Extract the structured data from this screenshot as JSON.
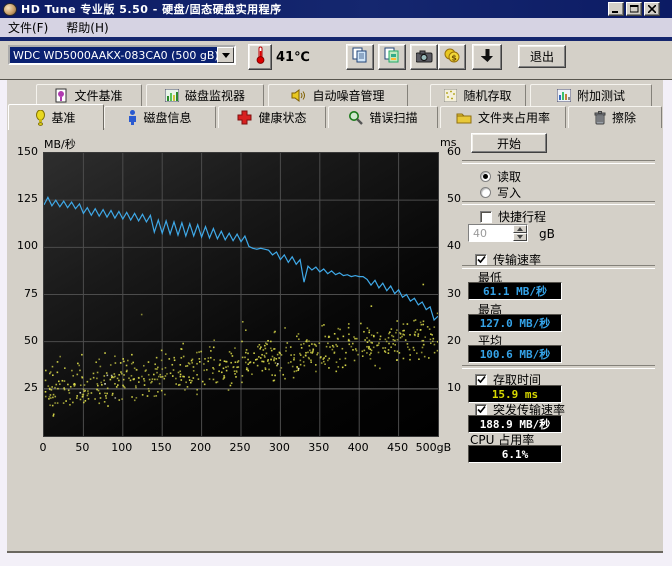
{
  "window": {
    "title": "HD Tune 专业版 5.50 - 硬盘/固态硬盘实用程序"
  },
  "menu": {
    "items": [
      "文件(F)",
      "帮助(H)"
    ]
  },
  "toolbar": {
    "drive_select": "WDC WD5000AAKX-083CA0 (500 gB)",
    "temperature": "41℃",
    "exit_label": "退出",
    "icons": [
      "copy-icon",
      "copy-image-icon",
      "screenshot-icon",
      "coins-icon",
      "save-results-icon"
    ]
  },
  "tabs": {
    "row1": [
      {
        "label": "文件基准",
        "icon": "file-benchmark-icon"
      },
      {
        "label": "磁盘监视器",
        "icon": "disk-monitor-icon"
      },
      {
        "label": "自动噪音管理",
        "icon": "speaker-icon"
      },
      {
        "label": "随机存取",
        "icon": "random-access-icon"
      },
      {
        "label": "附加测试",
        "icon": "extra-tests-icon"
      }
    ],
    "row2": [
      {
        "label": "基准",
        "icon": "benchmark-icon",
        "active": true
      },
      {
        "label": "磁盘信息",
        "icon": "disk-info-icon"
      },
      {
        "label": "健康状态",
        "icon": "health-icon"
      },
      {
        "label": "错误扫描",
        "icon": "error-scan-icon"
      },
      {
        "label": "文件夹占用率",
        "icon": "folder-icon"
      },
      {
        "label": "擦除",
        "icon": "trash-icon"
      }
    ]
  },
  "panel": {
    "start_label": "开始",
    "read_label": "读取",
    "write_label": "写入",
    "short_stroke_label": "快捷行程",
    "capacity_value": "40",
    "capacity_unit": "gB",
    "transfer_rate_label": "传输速率",
    "min_label": "最低",
    "min_value": "61.1 MB/秒",
    "max_label": "最高",
    "max_value": "127.0 MB/秒",
    "avg_label": "平均",
    "avg_value": "100.6 MB/秒",
    "access_time_label": "存取时间",
    "access_time_value": "15.9 ms",
    "burst_rate_label": "突发传输速率",
    "burst_rate_value": "188.9 MB/秒",
    "cpu_label": "CPU 占用率",
    "cpu_value": "6.1%"
  },
  "chart_data": {
    "type": "line",
    "title": "",
    "ylabel_left": "MB/秒",
    "ylabel_right": "ms",
    "x_range_gb": [
      0,
      500
    ],
    "y_left_range": [
      0,
      150
    ],
    "y_right_range": [
      0,
      60
    ],
    "x_tick_values": [
      0,
      50,
      100,
      150,
      200,
      250,
      300,
      350,
      400,
      450,
      500
    ],
    "x_tick_labels": [
      "0",
      "50",
      "100",
      "150",
      "200",
      "250",
      "300",
      "350",
      "400",
      "450",
      "500gB"
    ],
    "y_left_tick_values": [
      25,
      50,
      75,
      100,
      125,
      150
    ],
    "y_left_tick_labels": [
      "25",
      "50",
      "75",
      "100",
      "125",
      "150"
    ],
    "y_right_tick_values": [
      10,
      20,
      30,
      40,
      50,
      60
    ],
    "y_right_tick_labels": [
      "10",
      "20",
      "30",
      "40",
      "50",
      "60"
    ],
    "grid": true,
    "series": [
      {
        "name": "传输速率(读取)",
        "type": "line",
        "color": "#3fa9e8",
        "axis": "left",
        "x_step_gb": 5,
        "values": [
          122.5,
          126.5,
          122,
          125,
          121.5,
          124.5,
          121,
          124,
          120.5,
          123,
          118,
          121,
          117,
          120.5,
          116.5,
          120,
          116,
          119.5,
          115.5,
          119,
          115,
          118.5,
          114.5,
          118,
          114,
          117.5,
          113.5,
          117,
          108,
          114.5,
          107.5,
          114,
          107,
          113.5,
          106.5,
          113,
          106,
          112.5,
          106,
          112,
          105.5,
          111,
          105,
          110,
          104.5,
          108.5,
          104,
          107.5,
          103.5,
          107,
          103,
          106,
          100.5,
          99.5,
          99,
          99.5,
          99,
          98.5,
          96,
          97.5,
          93.5,
          96,
          92,
          95,
          91,
          93.5,
          81.5,
          90,
          88,
          89.5,
          87,
          88.5,
          86,
          87.5,
          85.5,
          86.5,
          85,
          85.5,
          84.5,
          85,
          84.5,
          84.5,
          83,
          80,
          82.5,
          78.5,
          81,
          77,
          79.5,
          75.5,
          77.5,
          73.5,
          75,
          71.5,
          73,
          69.5,
          71,
          67,
          68.5,
          61.5,
          63.5
        ]
      },
      {
        "name": "存取时间",
        "type": "scatter",
        "color": "#d9d94a",
        "axis": "right",
        "generator": {
          "seed": 12345,
          "count": 650,
          "center_ms_start": 9.5,
          "center_ms_end": 21.5,
          "spread_ms": 4.2,
          "outlier_chance": 0.025,
          "outlier_extra_ms": 10
        }
      }
    ],
    "summary": {
      "transfer_min_mb_s": 61.1,
      "transfer_max_mb_s": 127.0,
      "transfer_avg_mb_s": 100.6,
      "access_time_ms": 15.9,
      "burst_rate_mb_s": 188.9,
      "cpu_usage_pct": 6.1
    }
  }
}
